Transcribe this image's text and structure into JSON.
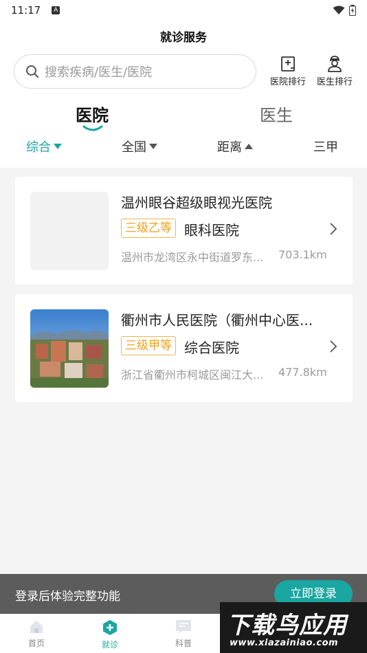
{
  "status_bar": {
    "time": "11:17",
    "notification_badge": "A"
  },
  "header": {
    "title": "就诊服务",
    "search_placeholder": "搜索疾病/医生/医院",
    "hospital_rank_label": "医院排行",
    "doctor_rank_label": "医生排行"
  },
  "tabs": {
    "hospital": "医院",
    "doctor": "医生",
    "active": "医院"
  },
  "filters": [
    {
      "label": "综合",
      "active": true,
      "indicator": "down"
    },
    {
      "label": "全国",
      "active": false,
      "indicator": "down"
    },
    {
      "label": "距离",
      "active": false,
      "indicator": "up"
    },
    {
      "label": "三甲",
      "active": false,
      "indicator": ""
    }
  ],
  "hospitals": [
    {
      "name": "温州眼谷超级眼视光医院",
      "level": "三级乙等",
      "type": "眼科医院",
      "address": "温州市龙湾区永中街道罗东...",
      "distance": "703.1km",
      "has_photo": false
    },
    {
      "name": "衢州市人民医院（衢州中心医...",
      "level": "三级甲等",
      "type": "综合医院",
      "address": "浙江省衢州市柯城区闽江大...",
      "distance": "477.8km",
      "has_photo": true
    }
  ],
  "login_prompt": {
    "text": "登录后体验完整功能",
    "button": "立即登录"
  },
  "bottom_nav": [
    {
      "label": "首页",
      "icon": "home-icon",
      "active": false
    },
    {
      "label": "就诊",
      "icon": "plus-hexagon-icon",
      "active": true
    },
    {
      "label": "科普",
      "icon": "message-icon",
      "active": false
    }
  ],
  "watermark": {
    "title": "下载鸟应用",
    "url": "www.xiazainiao.com"
  },
  "colors": {
    "accent": "#1aa6a1",
    "level_badge": "#f0a21a",
    "login_bar": "#5c5c5c"
  }
}
